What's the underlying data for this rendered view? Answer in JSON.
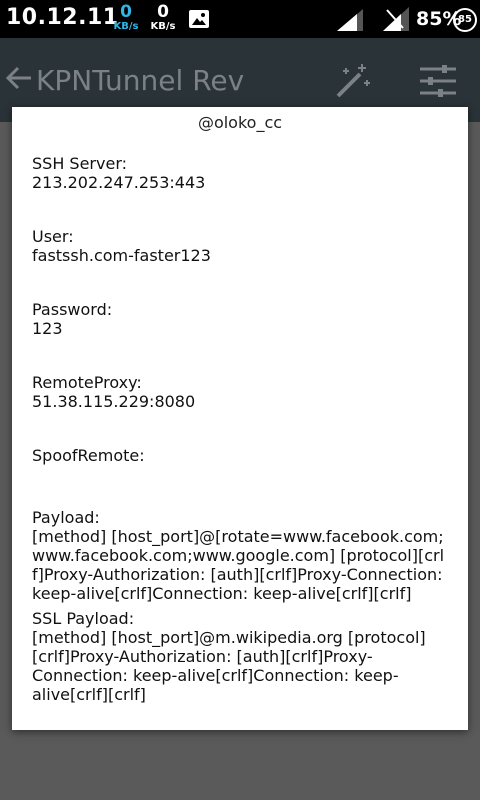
{
  "status_bar": {
    "time": "10.12.11",
    "upload_speed": "0",
    "upload_unit": "KB/s",
    "download_speed": "0",
    "download_unit": "KB/s",
    "battery_percent": "85%",
    "battery_level": "85"
  },
  "app_bar": {
    "title": "KPNTunnel Rev"
  },
  "dialog": {
    "title": "@oloko_cc",
    "fields": [
      {
        "label": "SSH Server:",
        "value": "213.202.247.253:443"
      },
      {
        "label": "User:",
        "value": "fastssh.com-faster123"
      },
      {
        "label": "Password:",
        "value": "123"
      },
      {
        "label": "RemoteProxy:",
        "value": "51.38.115.229:8080"
      },
      {
        "label": "SpoofRemote:",
        "value": ""
      },
      {
        "label": "Payload:",
        "value": "[method] [host_port]@[rotate=www.facebook.com;www.facebook.com;www.google.com] [protocol][crlf]Proxy-Authorization: [auth][crlf]Proxy-Connection: keep-alive[crlf]Connection: keep-alive[crlf][crlf]"
      },
      {
        "label": "SSL Payload:",
        "value": "[method] [host_port]@m.wikipedia.org [protocol][crlf]Proxy-Authorization: [auth][crlf]Proxy-Connection: keep-alive[crlf]Connection: keep-alive[crlf][crlf]"
      }
    ]
  },
  "colors": {
    "status_bar_bg": "#000000",
    "accent_blue": "#33b5e5",
    "app_bar_dimmed": "#2a3338",
    "dialog_bg": "#ffffff"
  },
  "icons": {
    "back": "arrow-left-icon",
    "magic": "magic-wand-icon",
    "tune": "tune-sliders-icon",
    "gallery": "gallery-icon",
    "signal": "signal-icon"
  }
}
